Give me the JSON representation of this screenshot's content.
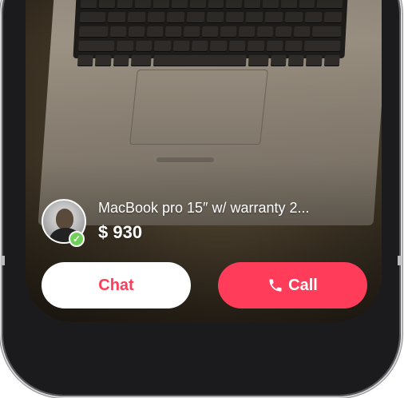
{
  "listing": {
    "title": "MacBook pro 15″ w/ warranty 2...",
    "price": "$ 930",
    "seller": {
      "verified_icon": "check-icon",
      "verified_color": "#6fcf5a"
    }
  },
  "actions": {
    "chat_label": "Chat",
    "call_label": "Call",
    "call_icon": "phone-icon",
    "accent_color": "#ff3d5a"
  },
  "icons": {
    "verified_glyph": "✓"
  }
}
